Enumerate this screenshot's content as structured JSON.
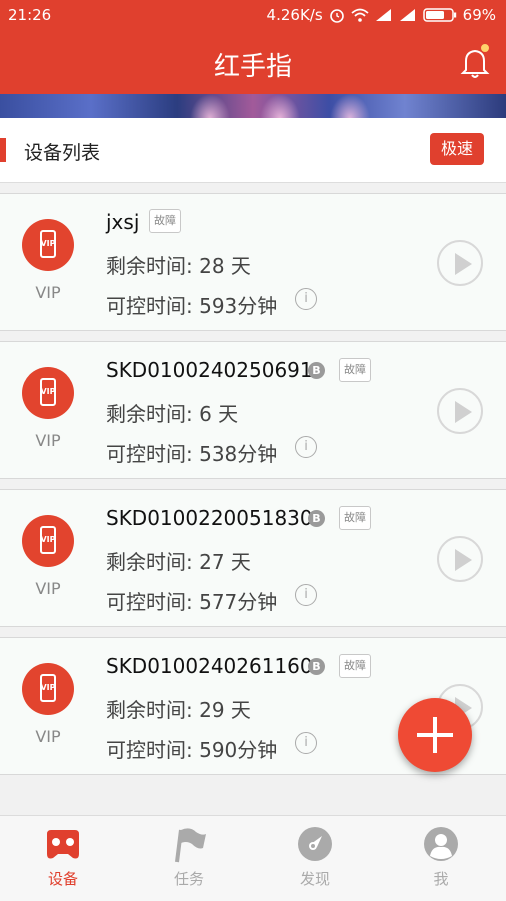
{
  "status_bar": {
    "time": "21:26",
    "speed": "4.26K/s",
    "battery": "69%"
  },
  "app_bar": {
    "title": "红手指"
  },
  "section": {
    "title": "设备列表",
    "speed_button": "极速"
  },
  "devices": [
    {
      "name": "jxsj",
      "has_badge": false,
      "badge": "",
      "status": "故障",
      "remaining": "剩余时间: 28 天",
      "controllable": "可控时间: 593分钟",
      "vip": "VIP"
    },
    {
      "name": "SKD0100240250691",
      "has_badge": true,
      "badge": "B",
      "status": "故障",
      "remaining": "剩余时间: 6 天",
      "controllable": "可控时间: 538分钟",
      "vip": "VIP"
    },
    {
      "name": "SKD0100220051830",
      "has_badge": true,
      "badge": "B",
      "status": "故障",
      "remaining": "剩余时间: 27 天",
      "controllable": "可控时间: 577分钟",
      "vip": "VIP"
    },
    {
      "name": "SKD0100240261160",
      "has_badge": true,
      "badge": "B",
      "status": "故障",
      "remaining": "剩余时间: 29 天",
      "controllable": "可控时间: 590分钟",
      "vip": "VIP"
    }
  ],
  "vip_icon_text": "VIP",
  "tabs": [
    {
      "label": "设备",
      "icon": "gamepad-icon",
      "active": true
    },
    {
      "label": "任务",
      "icon": "flag-icon",
      "active": false
    },
    {
      "label": "发现",
      "icon": "compass-icon",
      "active": false
    },
    {
      "label": "我",
      "icon": "person-icon",
      "active": false
    }
  ],
  "colors": {
    "primary": "#e0402e",
    "fab": "#ef4a34",
    "inactive": "#aaaaaa"
  }
}
